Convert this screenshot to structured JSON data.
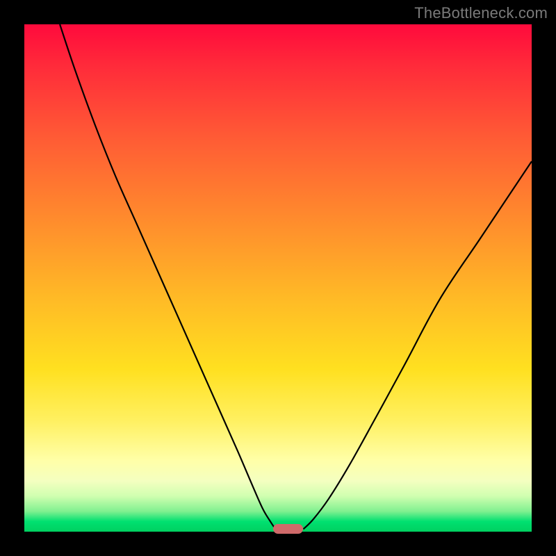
{
  "watermark": "TheBottleneck.com",
  "chart_data": {
    "type": "line",
    "title": "",
    "xlabel": "",
    "ylabel": "",
    "xlim": [
      0,
      100
    ],
    "ylim": [
      0,
      100
    ],
    "grid": false,
    "legend": false,
    "series": [
      {
        "name": "left-curve",
        "x": [
          7,
          10,
          14,
          18,
          22,
          26,
          30,
          34,
          38,
          42,
          45,
          47,
          48.5,
          49.5
        ],
        "y": [
          100,
          91,
          80,
          70,
          61,
          52,
          43,
          34,
          25,
          16,
          9,
          4.5,
          2,
          0.5
        ]
      },
      {
        "name": "right-curve",
        "x": [
          55,
          57,
          60,
          64,
          69,
          75,
          82,
          90,
          100
        ],
        "y": [
          0.5,
          2.5,
          6.5,
          13,
          22,
          33,
          46,
          58,
          73
        ]
      }
    ],
    "marker": {
      "x_center": 52,
      "width_pct": 6,
      "color": "#cf6a6a"
    },
    "gradient_stops": [
      {
        "pos": 0,
        "color": "#ff0a3c"
      },
      {
        "pos": 22,
        "color": "#ff5a35"
      },
      {
        "pos": 54,
        "color": "#ffba26"
      },
      {
        "pos": 86,
        "color": "#ffffa8"
      },
      {
        "pos": 100,
        "color": "#00d060"
      }
    ]
  }
}
